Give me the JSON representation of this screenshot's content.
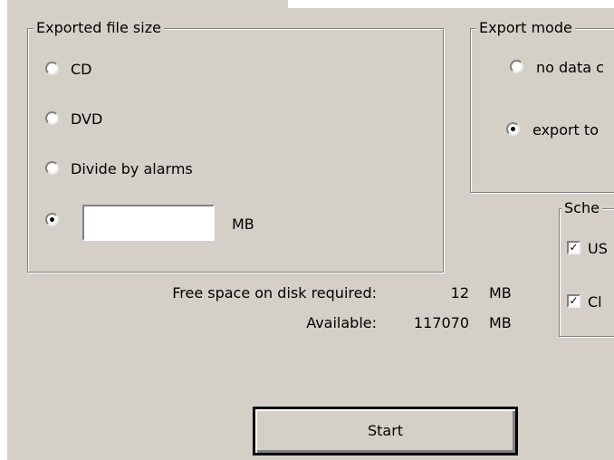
{
  "file_size": {
    "title": "Exported file size",
    "options": [
      "CD",
      "DVD",
      "Divide by alarms"
    ],
    "custom_selected": true,
    "custom_value": "",
    "custom_unit": "MB"
  },
  "export_mode": {
    "title": "Export mode",
    "options": [
      "no data c",
      "export to"
    ],
    "selected_index": 1
  },
  "schedule": {
    "title": "Sche",
    "items": [
      {
        "label": "US",
        "checked": true
      },
      {
        "label": "Cl",
        "checked": true
      }
    ]
  },
  "disk": {
    "required_label": "Free space on disk required:",
    "required_value": "12",
    "required_unit": "MB",
    "available_label": "Available:",
    "available_value": "117070",
    "available_unit": "MB"
  },
  "start_button": "Start"
}
